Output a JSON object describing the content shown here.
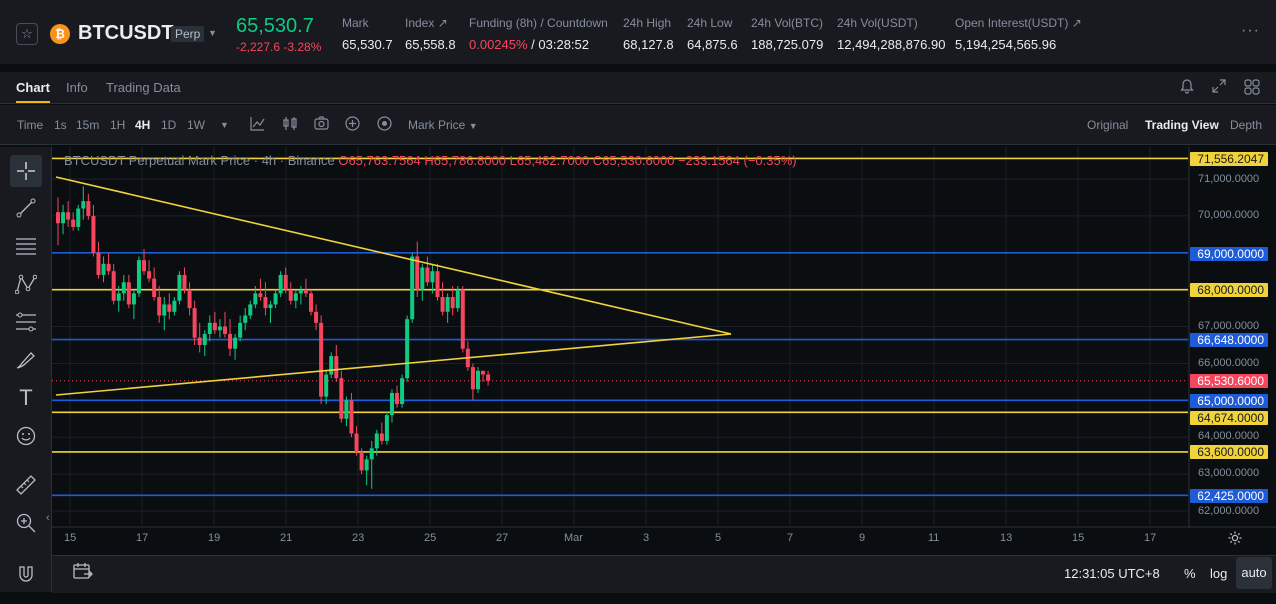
{
  "header": {
    "symbol": "BTCUSDT",
    "badge": "Perp",
    "last_price": "65,530.7",
    "change": "-2,227.6 -3.28%",
    "stats": [
      {
        "label": "Mark",
        "value": "65,530.7"
      },
      {
        "label": "Index ↗",
        "value": "65,558.8"
      },
      {
        "label": "Funding (8h) / Countdown",
        "value_red": "0.00245%",
        "value": " / 03:28:52"
      },
      {
        "label": "24h High",
        "value": "68,127.8"
      },
      {
        "label": "24h Low",
        "value": "64,875.6"
      },
      {
        "label": "24h Vol(BTC)",
        "value": "188,725.079"
      },
      {
        "label": "24h Vol(USDT)",
        "value": "12,494,288,876.90"
      },
      {
        "label": "Open Interest(USDT) ↗",
        "value": "5,194,254,565.96"
      }
    ],
    "more": "···"
  },
  "tabs": [
    "Chart",
    "Info",
    "Trading Data"
  ],
  "toolbar": {
    "left": [
      "Time",
      "1s",
      "15m",
      "1H",
      "4H",
      "1D",
      "1W"
    ],
    "active": "4H",
    "price_type": "Mark Price",
    "views": [
      "Original",
      "Trading View",
      "Depth"
    ],
    "active_view": "Trading View"
  },
  "legend": {
    "title": "BTCUSDT Perpetual Mark Price · 4h · Binance",
    "ohlc": "O65,763.7564 H65,786.8000 L65,482.7000 C65,530.6000 −233.1564 (−0.35%)"
  },
  "y_ticks": [
    "71,000.0000",
    "70,000.0000",
    "67,000.0000",
    "66,000.0000",
    "64,000.0000",
    "63,000.0000",
    "62,000.0000"
  ],
  "price_labels": [
    {
      "text": "71,556.2047",
      "color": "yellow"
    },
    {
      "text": "69,000.0000",
      "color": "blue"
    },
    {
      "text": "68,000.0000",
      "color": "yellow"
    },
    {
      "text": "66,648.0000",
      "color": "blue"
    },
    {
      "text": "65,530.6000",
      "color": "red"
    },
    {
      "text": "65,000.0000",
      "color": "blue"
    },
    {
      "text": "64,674.0000",
      "color": "yellow"
    },
    {
      "text": "63,600.0000",
      "color": "yellow"
    },
    {
      "text": "62,425.0000",
      "color": "blue"
    }
  ],
  "x_ticks": [
    "15",
    "17",
    "19",
    "21",
    "23",
    "25",
    "27",
    "Mar",
    "3",
    "5",
    "7",
    "9",
    "11",
    "13",
    "15",
    "17"
  ],
  "bottom": {
    "clock": "12:31:05 UTC+8",
    "percent": "%",
    "log": "log",
    "auto": "auto"
  },
  "colors": {
    "up": "#0ecb81",
    "down": "#f6465d",
    "yellow_line": "#f0d33a",
    "blue_line": "#1e5bd8"
  },
  "chart_data": {
    "type": "candlestick",
    "title": "BTCUSDT Perpetual Mark Price · 4h · Binance",
    "x_labels": [
      "15",
      "17",
      "19",
      "21",
      "23",
      "25",
      "27",
      "Mar",
      "3",
      "5",
      "7",
      "9",
      "11",
      "13",
      "15",
      "17"
    ],
    "horizontal_levels": [
      71556.2047,
      69000,
      68000,
      66648,
      65000,
      64674,
      63600,
      62425
    ],
    "current_price": 65530.6,
    "candles_ohlc": [
      [
        70100,
        70500,
        69200,
        69800
      ],
      [
        69800,
        70300,
        69500,
        70100
      ],
      [
        70100,
        70400,
        69700,
        69900
      ],
      [
        69900,
        70100,
        69600,
        69700
      ],
      [
        69700,
        70300,
        69600,
        70200
      ],
      [
        70200,
        70800,
        69900,
        70400
      ],
      [
        70400,
        70600,
        69900,
        70000
      ],
      [
        70000,
        70300,
        68900,
        69000
      ],
      [
        69000,
        69300,
        68300,
        68400
      ],
      [
        68400,
        68900,
        68200,
        68700
      ],
      [
        68700,
        69000,
        68400,
        68500
      ],
      [
        68500,
        68700,
        67600,
        67700
      ],
      [
        67700,
        68100,
        67400,
        67900
      ],
      [
        67900,
        68400,
        67700,
        68200
      ],
      [
        68200,
        68400,
        67500,
        67600
      ],
      [
        67600,
        68000,
        67200,
        67900
      ],
      [
        67900,
        68900,
        67800,
        68800
      ],
      [
        68800,
        69100,
        68400,
        68500
      ],
      [
        68500,
        68800,
        68200,
        68300
      ],
      [
        68300,
        68600,
        67700,
        67800
      ],
      [
        67800,
        68100,
        67100,
        67300
      ],
      [
        67300,
        67800,
        66900,
        67600
      ],
      [
        67600,
        67900,
        67200,
        67400
      ],
      [
        67400,
        67800,
        67300,
        67700
      ],
      [
        67700,
        68500,
        67600,
        68400
      ],
      [
        68400,
        68600,
        67900,
        68000
      ],
      [
        68000,
        68200,
        67300,
        67500
      ],
      [
        67500,
        67700,
        66500,
        66700
      ],
      [
        66700,
        67100,
        66300,
        66500
      ],
      [
        66500,
        66900,
        66200,
        66800
      ],
      [
        66800,
        67300,
        66600,
        67100
      ],
      [
        67100,
        67400,
        66800,
        66900
      ],
      [
        66900,
        67200,
        66700,
        67000
      ],
      [
        67000,
        67400,
        66700,
        66800
      ],
      [
        66800,
        67200,
        66200,
        66400
      ],
      [
        66400,
        66800,
        66100,
        66700
      ],
      [
        66700,
        67300,
        66600,
        67100
      ],
      [
        67100,
        67500,
        66900,
        67300
      ],
      [
        67300,
        67700,
        67200,
        67600
      ],
      [
        67600,
        68100,
        67500,
        67900
      ],
      [
        67900,
        68300,
        67700,
        67800
      ],
      [
        67800,
        68200,
        67300,
        67500
      ],
      [
        67500,
        67700,
        67100,
        67600
      ],
      [
        67600,
        68000,
        67500,
        67900
      ],
      [
        67900,
        68500,
        67800,
        68400
      ],
      [
        68400,
        68600,
        67900,
        68000
      ],
      [
        68000,
        68200,
        67600,
        67700
      ],
      [
        67700,
        68000,
        67500,
        67900
      ],
      [
        67900,
        68100,
        67600,
        68000
      ],
      [
        68000,
        68300,
        67800,
        67900
      ],
      [
        67900,
        68000,
        67300,
        67400
      ],
      [
        67400,
        67600,
        66900,
        67100
      ],
      [
        67100,
        67300,
        64900,
        65100
      ],
      [
        65100,
        65800,
        64900,
        65700
      ],
      [
        65700,
        66300,
        65600,
        66200
      ],
      [
        66200,
        66500,
        65500,
        65600
      ],
      [
        65600,
        65800,
        64400,
        64500
      ],
      [
        64500,
        65100,
        64300,
        65000
      ],
      [
        65000,
        65200,
        64000,
        64100
      ],
      [
        64100,
        64300,
        63500,
        63600
      ],
      [
        63600,
        63700,
        63000,
        63100
      ],
      [
        63100,
        63500,
        62700,
        63400
      ],
      [
        63400,
        63900,
        62600,
        63700
      ],
      [
        63700,
        64200,
        63500,
        64100
      ],
      [
        64100,
        64400,
        63800,
        63900
      ],
      [
        63900,
        64700,
        63800,
        64600
      ],
      [
        64600,
        65300,
        64400,
        65200
      ],
      [
        65200,
        65400,
        64800,
        64900
      ],
      [
        64900,
        65700,
        64800,
        65600
      ],
      [
        65600,
        67300,
        65500,
        67200
      ],
      [
        67200,
        69000,
        67100,
        68900
      ],
      [
        68900,
        69300,
        67800,
        68000
      ],
      [
        68000,
        68700,
        67700,
        68600
      ],
      [
        68600,
        68900,
        68100,
        68200
      ],
      [
        68200,
        68700,
        67900,
        68500
      ],
      [
        68500,
        68700,
        67700,
        67800
      ],
      [
        67800,
        68200,
        67300,
        67400
      ],
      [
        67400,
        67900,
        67100,
        67800
      ],
      [
        67800,
        68100,
        67300,
        67500
      ],
      [
        67500,
        68100,
        67400,
        68000
      ],
      [
        68000,
        68100,
        66300,
        66400
      ],
      [
        66400,
        66600,
        65800,
        65900
      ],
      [
        65900,
        66000,
        65000,
        65300
      ],
      [
        65300,
        65900,
        65200,
        65800
      ],
      [
        65800,
        65800,
        65500,
        65700
      ],
      [
        65700,
        65800,
        65400,
        65530
      ]
    ]
  }
}
